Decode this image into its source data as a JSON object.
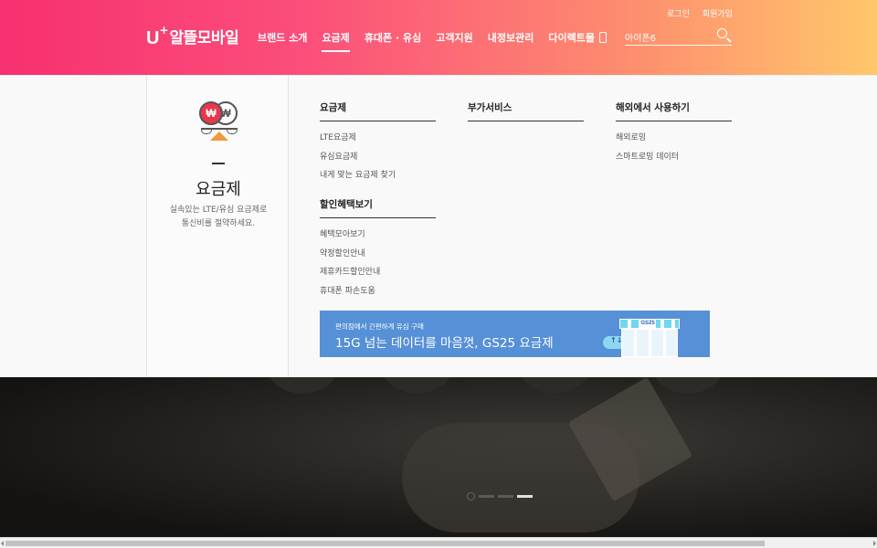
{
  "header": {
    "logo": {
      "u": "U",
      "plus": "+",
      "name": "알뜰모바일"
    },
    "util_links": [
      "로그인",
      "회원가입"
    ],
    "nav": [
      {
        "label": "브랜드 소개",
        "active": false
      },
      {
        "label": "요금제",
        "active": true
      },
      {
        "label": "휴대폰 · 유심",
        "active": false
      },
      {
        "label": "고객지원",
        "active": false
      },
      {
        "label": "내정보관리",
        "active": false
      },
      {
        "label": "다이렉트몰",
        "active": false
      }
    ],
    "search": {
      "value": "아이폰6",
      "icon": "search-icon"
    }
  },
  "menu": {
    "side": {
      "icon": "coin-scale-icon",
      "coin_red": "₩",
      "coin_grey": "₩",
      "title": "요금제",
      "desc_lines": [
        "실속있는 LTE/유심 요금제로",
        "통신비를 절약하세요."
      ]
    },
    "columns": [
      {
        "title": "요금제",
        "items": [
          "LTE요금제",
          "유심요금제",
          "내게 맞는 요금제 찾기"
        ]
      },
      {
        "title": "할인혜택보기",
        "items": [
          "혜택모아보기",
          "약정할인안내",
          "제휴카드할인안내",
          "휴대폰 파손도움"
        ]
      },
      {
        "title": "부가서비스",
        "items": []
      },
      {
        "title": "해외에서 사용하기",
        "items": [
          "해외로밍",
          "스마트로밍 데이터"
        ]
      }
    ],
    "banner": {
      "small": "편의점에서 간편하게 유심 구매",
      "big": "15G 넘는 데이터를 마음껏, GS25 요금제",
      "sign": "GS25",
      "cloud": "↑↓",
      "colors": {
        "bg": "#5690d6"
      }
    }
  },
  "slider": {
    "slides": 4,
    "active_index": 3
  },
  "colors": {
    "brand_start": "#f7306f",
    "brand_end": "#ffc76b"
  }
}
